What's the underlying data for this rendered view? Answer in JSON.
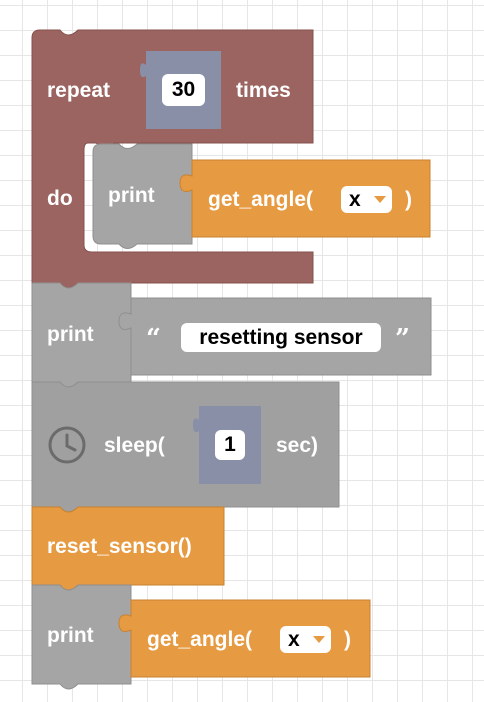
{
  "colors": {
    "loop": "#9c6461",
    "loop_stroke": "#85504d",
    "text_block": "#a5a5a5",
    "text_block_stroke": "#8f8f8f",
    "sleep_block": "#a0a0a0",
    "function": "#e69a41",
    "function_stroke": "#c98230",
    "number_slot": "#8a8fa8",
    "grid": "#e6e6e6"
  },
  "blocks": {
    "repeat": {
      "keyword": "repeat",
      "count": "30",
      "suffix": "times",
      "do_label": "do"
    },
    "print_angle_inner": {
      "keyword": "print",
      "call": "get_angle(",
      "arg": "x",
      "close": ")"
    },
    "print_text": {
      "keyword": "print",
      "open_quote": "“",
      "text": "resetting sensor",
      "close_quote": "”"
    },
    "sleep": {
      "icon": "clock-icon",
      "call": "sleep(",
      "seconds": "1",
      "unit": "sec)"
    },
    "reset": {
      "call": "reset_sensor()"
    },
    "print_angle_outer": {
      "keyword": "print",
      "call": "get_angle(",
      "arg": "x",
      "close": ")"
    }
  }
}
